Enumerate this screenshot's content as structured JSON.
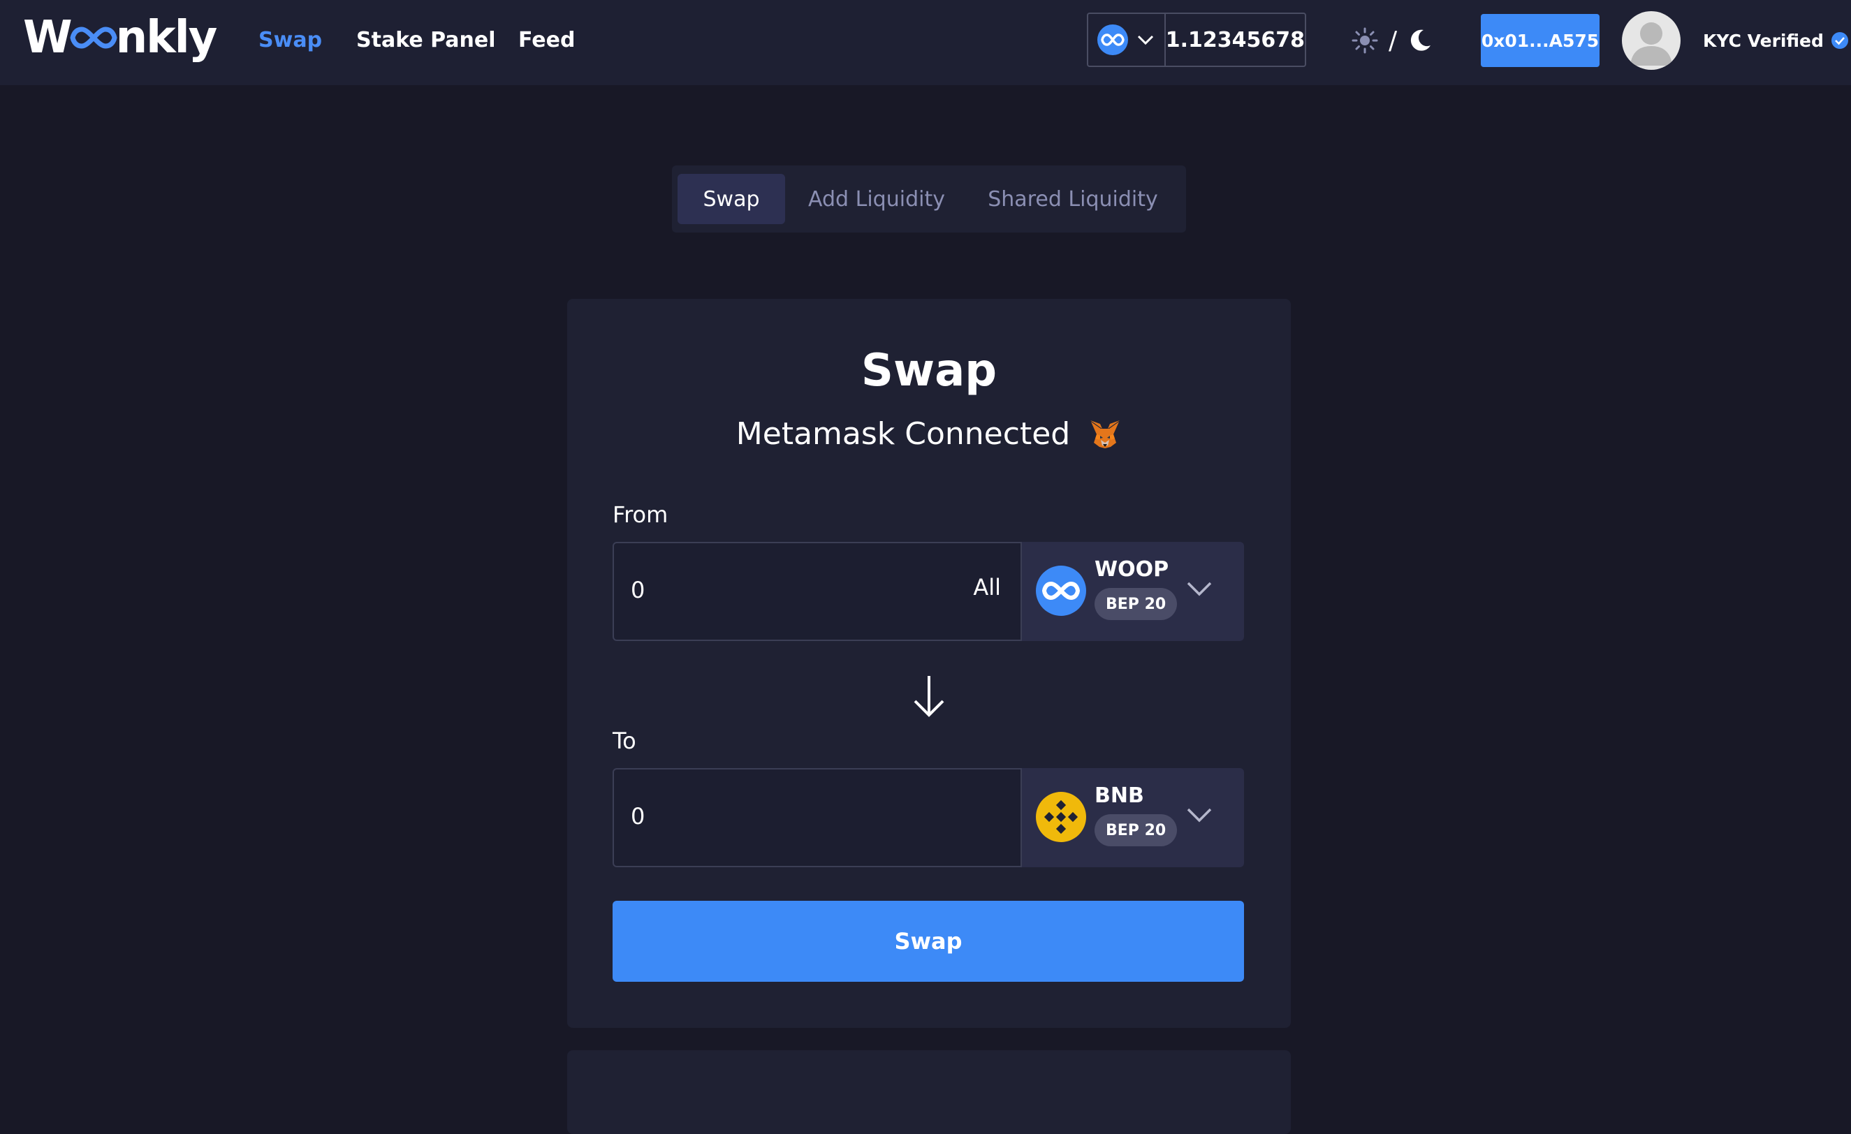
{
  "brand": {
    "logo_prefix": "W",
    "logo_suffix": "nkly"
  },
  "nav": {
    "items": [
      {
        "label": "Swap",
        "active": true
      },
      {
        "label": "Stake Panel",
        "active": false
      },
      {
        "label": "Feed",
        "active": false
      }
    ]
  },
  "header": {
    "token_icon": "infinity-icon",
    "balance": "1.12345678",
    "theme_separator": "/",
    "wallet_address": "0x01...A575",
    "kyc_status": "KYC Verified"
  },
  "tabs": [
    {
      "label": "Swap",
      "active": true
    },
    {
      "label": "Add Liquidity",
      "active": false
    },
    {
      "label": "Shared Liquidity",
      "active": false
    }
  ],
  "swap": {
    "title": "Swap",
    "connection_status": "Metamask Connected",
    "from": {
      "label": "From",
      "value": "0",
      "all_label": "All",
      "token_symbol": "WOOP",
      "token_standard": "BEP 20"
    },
    "to": {
      "label": "To",
      "value": "0",
      "token_symbol": "BNB",
      "token_standard": "BEP 20"
    },
    "submit_label": "Swap"
  },
  "colors": {
    "accent": "#3d8af7",
    "background": "#181826",
    "panel": "#1f2133",
    "bnb_yellow": "#f0b90b"
  }
}
